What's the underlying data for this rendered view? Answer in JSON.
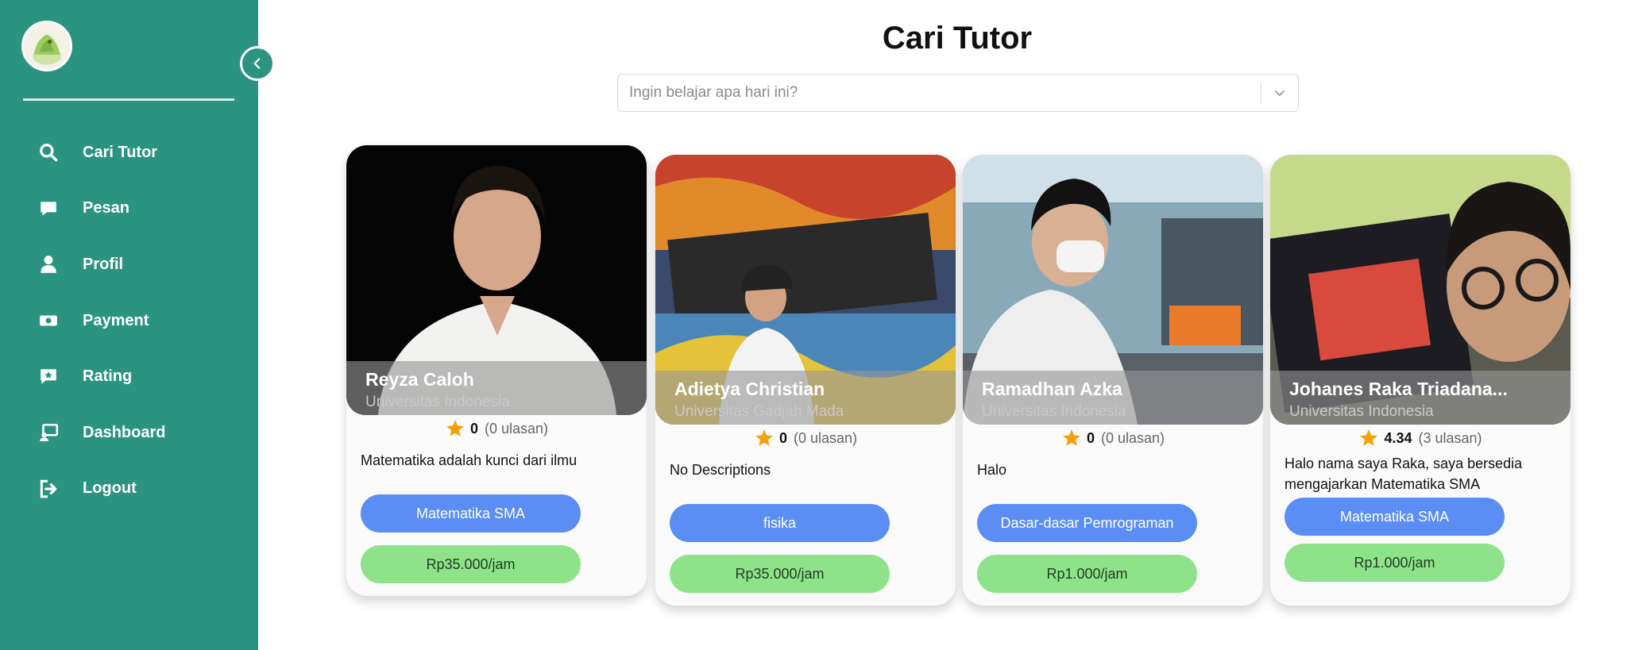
{
  "page": {
    "title": "Cari Tutor"
  },
  "search": {
    "placeholder": "Ingin belajar apa hari ini?"
  },
  "sidebar": {
    "items": [
      {
        "label": "Cari Tutor",
        "icon": "search-icon"
      },
      {
        "label": "Pesan",
        "icon": "chat-icon"
      },
      {
        "label": "Profil",
        "icon": "user-icon"
      },
      {
        "label": "Payment",
        "icon": "payment-icon"
      },
      {
        "label": "Rating",
        "icon": "rating-icon"
      },
      {
        "label": "Dashboard",
        "icon": "dashboard-icon"
      },
      {
        "label": "Logout",
        "icon": "logout-icon"
      }
    ]
  },
  "colors": {
    "sidebar": "#2a9480",
    "subject_pill": "#5b8ef5",
    "price_pill": "#8ee38a",
    "star": "#f4a20c"
  },
  "tutors": [
    {
      "name": "Reyza Caloh",
      "university": "Universitas Indonesia",
      "rating": "0",
      "reviews": "(0 ulasan)",
      "description": "Matematika adalah kunci dari ilmu",
      "subject": "Matematika SMA",
      "price": "Rp35.000/jam"
    },
    {
      "name": "Adietya Christian",
      "university": "Universitas Gadjah Mada",
      "rating": "0",
      "reviews": "(0 ulasan)",
      "description": "No Descriptions",
      "subject": "fisika",
      "price": "Rp35.000/jam"
    },
    {
      "name": "Ramadhan Azka",
      "university": "Universitas Indonesia",
      "rating": "0",
      "reviews": "(0 ulasan)",
      "description": "Halo",
      "subject": "Dasar-dasar Pemrograman",
      "price": "Rp1.000/jam"
    },
    {
      "name": "Johanes Raka Triadana...",
      "university": "Universitas Indonesia",
      "rating": "4.34",
      "reviews": "(3 ulasan)",
      "description": "Halo nama saya Raka, saya bersedia mengajarkan Matematika SMA",
      "subject": "Matematika SMA",
      "price": "Rp1.000/jam"
    }
  ]
}
